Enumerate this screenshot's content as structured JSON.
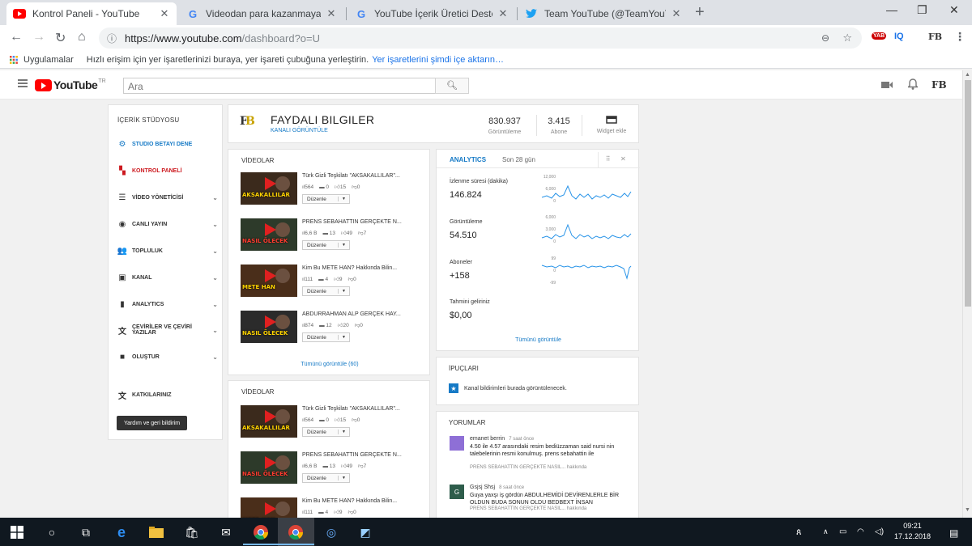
{
  "browser": {
    "tabs": [
      {
        "title": "Kontrol Paneli - YouTube",
        "favicon": "youtube-favicon",
        "active": true
      },
      {
        "title": "Videodan para kazanmaya ilişkin",
        "favicon": "google-favicon",
        "active": false
      },
      {
        "title": "YouTube İçerik Üretici Destek Eki",
        "favicon": "google-favicon",
        "active": false
      },
      {
        "title": "Team YouTube (@TeamYouTube)",
        "favicon": "twitter-favicon",
        "active": false
      }
    ],
    "close_glyph": "✕",
    "new_tab": "+",
    "url_host": "https://www.youtube.com",
    "url_path": "/dashboard?o=U",
    "extensions": {
      "yab": "YAB",
      "iq": "IQ"
    },
    "bookmarks": {
      "apps": "Uygulamalar",
      "hint": "Hızlı erişim için yer işaretlerinizi buraya, yer işareti çubuğuna yerleştirin.",
      "import_link": "Yer işaretlerini şimdi içe aktarın…"
    }
  },
  "masthead": {
    "logo_word": "YouTube",
    "country": "TR",
    "search_placeholder": "Ara"
  },
  "sidebar": {
    "heading": "İÇERİK STÜDYOSU",
    "items": [
      {
        "label": "STUDIO BETAYI DENE",
        "icon": "gear-icon",
        "glyph": "⚙",
        "style": "active",
        "chevron": false
      },
      {
        "label": "KONTROL PANELİ",
        "icon": "dashboard-icon",
        "glyph": "▚",
        "style": "red",
        "chevron": false
      },
      {
        "label": "VİDEO YÖNETİCİSİ",
        "icon": "video-manager-icon",
        "glyph": "☰",
        "style": "",
        "chevron": true
      },
      {
        "label": "CANLI YAYIN",
        "icon": "live-icon",
        "glyph": "◉",
        "style": "",
        "chevron": true
      },
      {
        "label": "TOPLULUK",
        "icon": "community-icon",
        "glyph": "👥",
        "style": "",
        "chevron": true
      },
      {
        "label": "KANAL",
        "icon": "channel-icon",
        "glyph": "▣",
        "style": "",
        "chevron": true
      },
      {
        "label": "ANALYTICS",
        "icon": "analytics-icon",
        "glyph": "▮",
        "style": "",
        "chevron": true
      },
      {
        "label": "ÇEVİRİLER VE ÇEVİRİ YAZILAR",
        "icon": "translate-icon",
        "glyph": "文",
        "style": "",
        "chevron": true
      },
      {
        "label": "OLUŞTUR",
        "icon": "create-icon",
        "glyph": "■",
        "style": "",
        "chevron": true
      },
      {
        "label": "KATKILARINIZ",
        "icon": "contributions-icon",
        "glyph": "文",
        "style": "",
        "chevron": false
      }
    ],
    "feedback": "Yardım ve geri bildirim"
  },
  "channel": {
    "name": "FAYDALI BILGILER",
    "view_link": "KANALI GÖRÜNTÜLE",
    "views": "830.937",
    "views_label": "Görüntüleme",
    "subs": "3.415",
    "subs_label": "Abone",
    "widget_label": "Widget ekle"
  },
  "videos_heading": "VİDEOLAR",
  "videos": [
    {
      "title": "Türk Gizli Teşkilatı \"AKSAKALLILAR\"...",
      "views": "564",
      "comments": "0",
      "likes": "15",
      "dislikes": "0",
      "thumb_text": "AKSAKALLILAR",
      "thumb_bg": "#3b2a1c",
      "thumb_color": "#ffd400"
    },
    {
      "title": "PRENS SEBAHATTIN GERÇEKTE N...",
      "views": "6,6 B",
      "comments": "13",
      "likes": "49",
      "dislikes": "7",
      "thumb_text": "NASIL ÖLECEK",
      "thumb_bg": "#2d3a2a",
      "thumb_color": "#ff3b2f"
    },
    {
      "title": "Kim Bu METE HAN? Hakkında Bilin...",
      "views": "111",
      "comments": "4",
      "likes": "9",
      "dislikes": "0",
      "thumb_text": "METE HAN",
      "thumb_bg": "#4a2e1a",
      "thumb_color": "#ffd400"
    },
    {
      "title": "ABDURRAHMAN ALP GERÇEK HAY...",
      "views": "874",
      "comments": "12",
      "likes": "20",
      "dislikes": "0",
      "thumb_text": "NASIL ÖLECEK",
      "thumb_bg": "#2b2b2b",
      "thumb_color": "#ffd400"
    }
  ],
  "videos2": [
    {
      "title": "Türk Gizli Teşkilatı \"AKSAKALLILAR\"...",
      "views": "564",
      "comments": "0",
      "likes": "15",
      "dislikes": "0",
      "thumb_text": "AKSAKALLILAR",
      "thumb_bg": "#3b2a1c",
      "thumb_color": "#ffd400"
    },
    {
      "title": "PRENS SEBAHATTIN GERÇEKTE N...",
      "views": "6,6 B",
      "comments": "13",
      "likes": "49",
      "dislikes": "7",
      "thumb_text": "NASIL ÖLECEK",
      "thumb_bg": "#2d3a2a",
      "thumb_color": "#ff3b2f"
    },
    {
      "title": "Kim Bu METE HAN? Hakkında Bilin...",
      "views": "111",
      "comments": "4",
      "likes": "9",
      "dislikes": "0",
      "thumb_text": "METE HAN",
      "thumb_bg": "#4a2e1a",
      "thumb_color": "#ffd400"
    }
  ],
  "edit_label": "Düzenle",
  "see_all": "Tümünü görüntüle (60)",
  "analytics": {
    "title": "ANALYTICS",
    "period": "Son 28 gün",
    "metrics": [
      {
        "label": "İzlenme süresi (dakika)",
        "value": "146.824",
        "ticks": [
          "12,000",
          "6,000",
          "0"
        ]
      },
      {
        "label": "Görüntüleme",
        "value": "54.510",
        "ticks": [
          "6,000",
          "3,000",
          "0"
        ]
      },
      {
        "label": "Aboneler",
        "value": "+158",
        "ticks": [
          "99",
          "0",
          "-99"
        ]
      },
      {
        "label": "Tahmini geliriniz",
        "value": "$0,00",
        "ticks": []
      }
    ],
    "see_all": "Tümünü görüntüle"
  },
  "tips": {
    "heading": "İPUÇLARI",
    "text": "Kanal bildirimleri burada görüntülenecek."
  },
  "comments": {
    "heading": "YORUMLAR",
    "items": [
      {
        "name": "emanet berrin",
        "time": "7 saat önce",
        "text": "4.50 ile 4.57 arasındaki resim bediüzzaman said nursi nin talebelerinin resmi konulmuş. prens sebahattin ile",
        "ref": "PRENS SEBAHATTIN GERÇEKTE NASIL...",
        "ref_suffix": "hakkında",
        "avatar": "",
        "avatar_color": "#8e6fd6"
      },
      {
        "name": "Gsjsj Shsj",
        "time": "8 saat önce",
        "text": "Guya yaxşı iş gördün ABDULHEMİDİ DEVİRENLERLE BİR OLDUN BUDA SONUN OLDU BEDBEXT İNSAN",
        "ref": "PRENS SEBAHATTIN GERÇEKTE NASIL...",
        "ref_suffix": "hakkında",
        "avatar": "G",
        "avatar_color": "#2e5d4b"
      }
    ]
  },
  "taskbar": {
    "time": "09:21",
    "date": "17.12.2018"
  },
  "colors": {
    "accent": "#167ac6",
    "red": "#cc181e",
    "chart": "#2793e8"
  }
}
